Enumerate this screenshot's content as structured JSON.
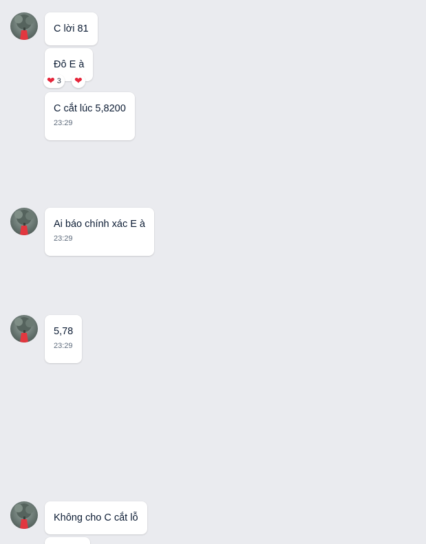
{
  "messages": [
    {
      "text": "C lời 81"
    },
    {
      "text": "Đô E à",
      "reactions": {
        "count": "3",
        "icon": "heart-icon"
      }
    },
    {
      "text": "C cắt lúc 5,8200",
      "time": "23:29"
    },
    {
      "text": "Ai báo chính xác E à",
      "time": "23:29"
    },
    {
      "text": "5,78",
      "time": "23:29"
    },
    {
      "text": "Không cho C cắt lỗ"
    }
  ],
  "colors": {
    "background": "#eaebef",
    "bubble": "#ffffff",
    "heart": "#e5253a"
  }
}
